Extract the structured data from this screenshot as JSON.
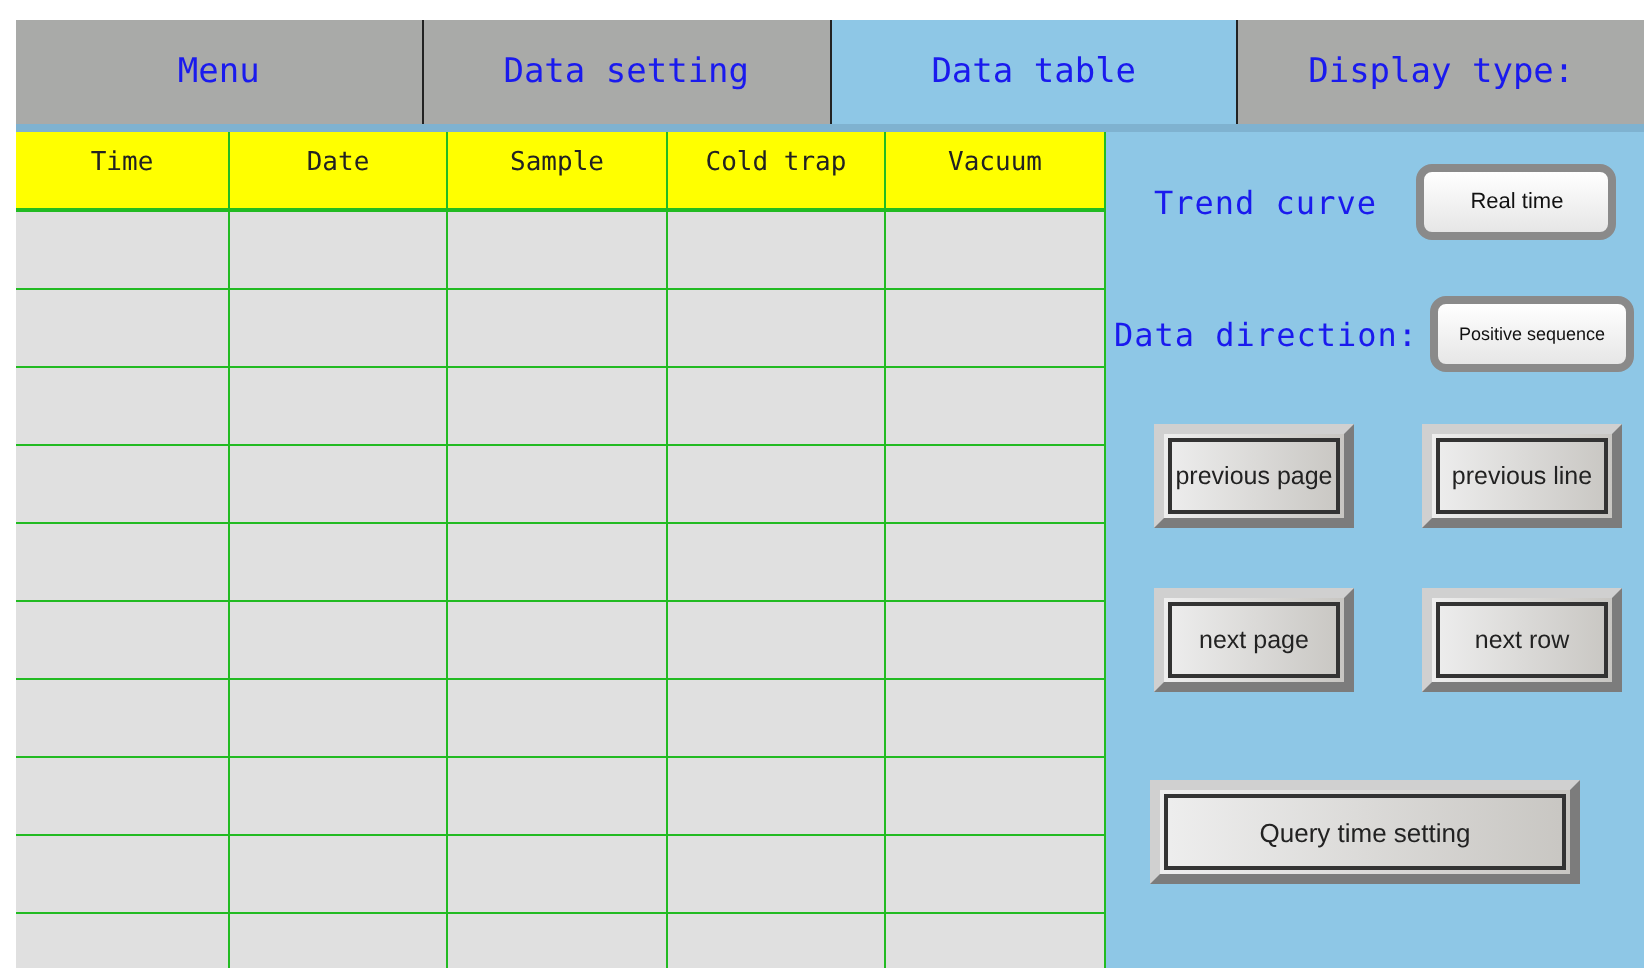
{
  "tabs": [
    {
      "label": "Menu",
      "selected": false
    },
    {
      "label": "Data setting",
      "selected": false
    },
    {
      "label": "Data table",
      "selected": true
    },
    {
      "label": "Display type:",
      "selected": false
    }
  ],
  "table": {
    "columns": [
      "Time",
      "Date",
      "Sample",
      "Cold trap",
      "Vacuum"
    ]
  },
  "trend_curve": {
    "label": "Trend curve",
    "button": "Real time"
  },
  "data_direction": {
    "label": "Data direction:",
    "button": "Positive sequence"
  },
  "nav_buttons": [
    "previous page",
    "previous line",
    "next page",
    "next row"
  ],
  "query_button": "Query time setting"
}
